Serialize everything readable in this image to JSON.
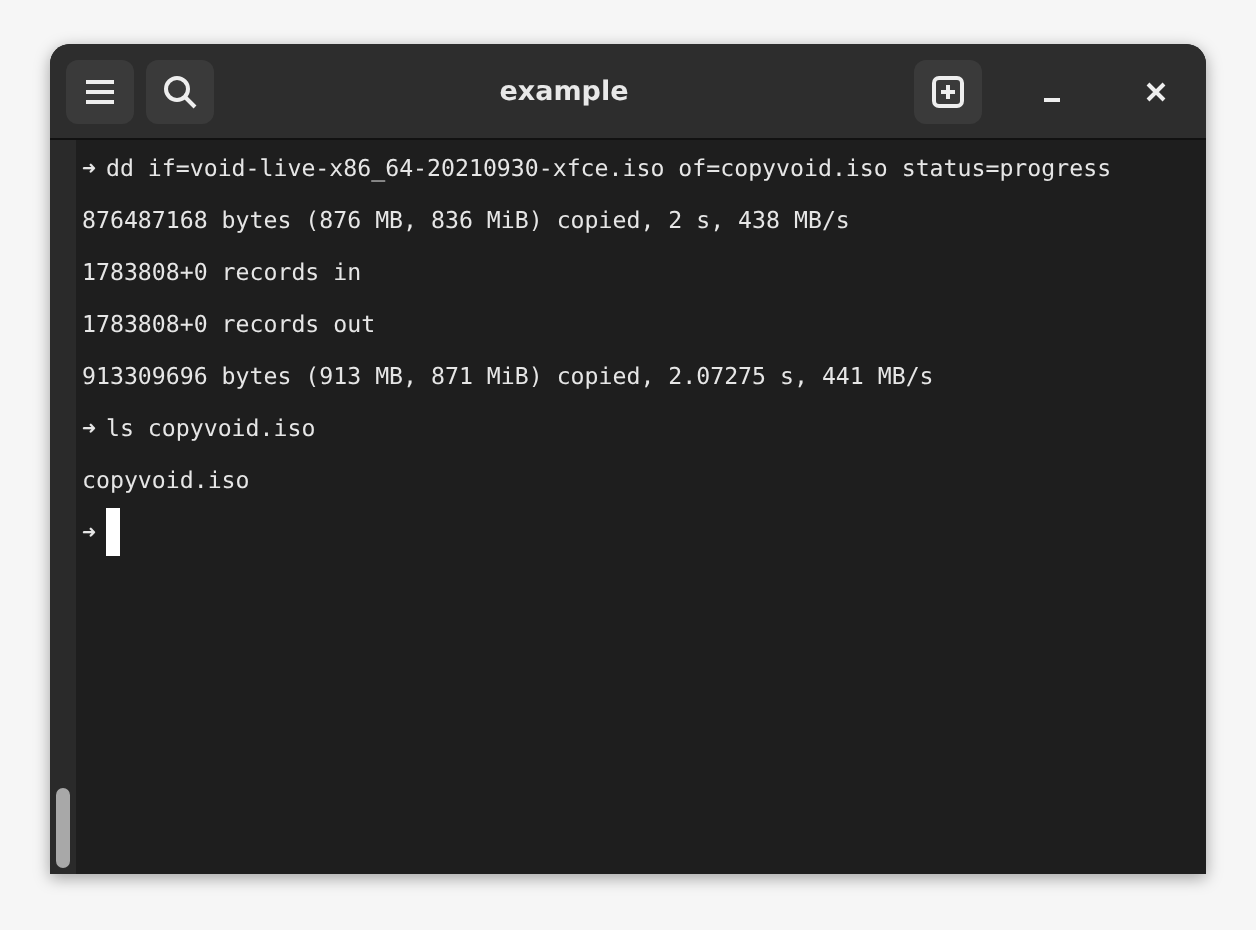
{
  "window": {
    "title": "example"
  },
  "terminal": {
    "lines": [
      {
        "kind": "prompt",
        "arrow": "➜",
        "text": "dd if=void-live-x86_64-20210930-xfce.iso of=copyvoid.iso status=progress"
      },
      {
        "kind": "output",
        "text": "876487168 bytes (876 MB, 836 MiB) copied, 2 s, 438 MB/s"
      },
      {
        "kind": "output",
        "text": "1783808+0 records in"
      },
      {
        "kind": "output",
        "text": "1783808+0 records out"
      },
      {
        "kind": "output",
        "text": "913309696 bytes (913 MB, 871 MiB) copied, 2.07275 s, 441 MB/s"
      },
      {
        "kind": "prompt",
        "arrow": "➜",
        "text": "ls copyvoid.iso"
      },
      {
        "kind": "output",
        "text": "copyvoid.iso"
      },
      {
        "kind": "prompt",
        "arrow": "➜",
        "cursor": true
      }
    ]
  }
}
